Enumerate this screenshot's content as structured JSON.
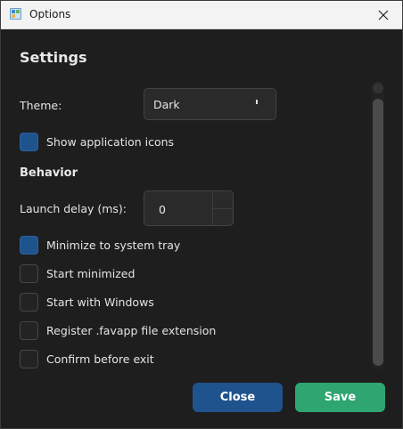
{
  "window": {
    "title": "Options",
    "icon": "app-window-icon",
    "close_icon": "close-icon"
  },
  "settings": {
    "heading": "Settings",
    "theme_label": "Theme:",
    "theme_value": "Dark",
    "show_icons_label": "Show application icons",
    "show_icons_checked": true
  },
  "behavior": {
    "heading": "Behavior",
    "launch_delay_label": "Launch delay (ms):",
    "launch_delay_value": "0",
    "options": [
      {
        "label": "Minimize to system tray",
        "checked": true
      },
      {
        "label": "Start minimized",
        "checked": false
      },
      {
        "label": "Start with Windows",
        "checked": false
      },
      {
        "label": "Register .favapp file extension",
        "checked": false
      },
      {
        "label": "Confirm before exit",
        "checked": false
      }
    ]
  },
  "buttons": {
    "close_label": "Close",
    "save_label": "Save"
  },
  "colors": {
    "accent_blue": "#1f538d",
    "accent_green": "#2fa572",
    "background": "#1e1e1e"
  }
}
